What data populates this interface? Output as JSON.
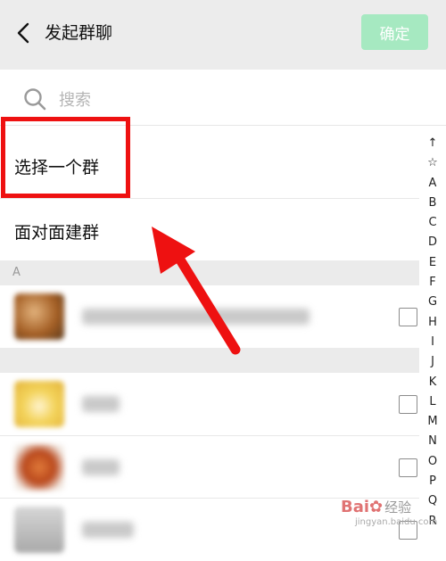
{
  "header": {
    "title": "发起群聊",
    "confirm_label": "确定"
  },
  "search": {
    "placeholder": "搜索"
  },
  "actions": [
    {
      "label": "选择一个群"
    },
    {
      "label": "面对面建群"
    }
  ],
  "sections": [
    {
      "letter": "A"
    },
    {
      "letter": ""
    }
  ],
  "contacts": [
    {
      "section": "A",
      "avatar_color": "#b8742c",
      "name_blurred": true,
      "checked": false
    },
    {
      "section": "",
      "avatar_color": "#f1c84e",
      "name_blurred": true,
      "checked": false
    },
    {
      "section": "",
      "avatar_color": "#cf5a24",
      "name_blurred": true,
      "checked": false
    },
    {
      "section": "",
      "avatar_color": "#bdbdbd",
      "name_blurred": true,
      "checked": false
    }
  ],
  "index_bar": [
    "↑",
    "☆",
    "A",
    "B",
    "C",
    "D",
    "E",
    "F",
    "G",
    "H",
    "I",
    "J",
    "K",
    "L",
    "M",
    "N",
    "O",
    "P",
    "Q",
    "R"
  ],
  "watermark": {
    "logo": "Bai",
    "text": "经验",
    "url": "jingyan.baidu.com"
  },
  "colors": {
    "accent": "#a6e9c1",
    "highlight": "#ee1111",
    "header_bg": "#ececec"
  }
}
